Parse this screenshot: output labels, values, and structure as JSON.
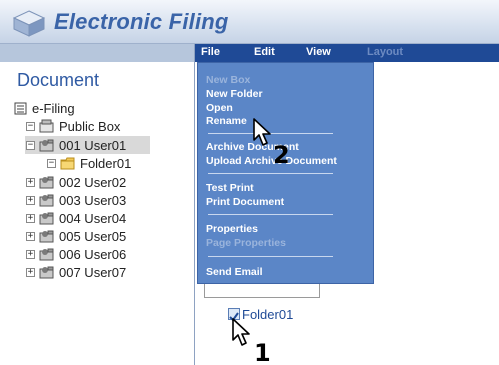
{
  "header": {
    "app_title": "Electronic Filing",
    "logo_icon": "cube-logo-icon"
  },
  "sidebar": {
    "heading": "Document",
    "root": "e-Filing",
    "items": [
      {
        "label": "Public Box",
        "expander": "−"
      },
      {
        "label": "001 User01",
        "expander": "−",
        "selected": true
      },
      {
        "label": "Folder01",
        "expander": "−"
      },
      {
        "label": "002 User02",
        "expander": "+"
      },
      {
        "label": "003 User03",
        "expander": "+"
      },
      {
        "label": "004 User04",
        "expander": "+"
      },
      {
        "label": "005 User05",
        "expander": "+"
      },
      {
        "label": "006 User06",
        "expander": "+"
      },
      {
        "label": "007 User07",
        "expander": "+"
      }
    ]
  },
  "menubar": {
    "file": "File",
    "edit": "Edit",
    "view": "View",
    "layout": "Layout"
  },
  "file_menu": {
    "new_box": "New Box",
    "new_folder": "New Folder",
    "open": "Open",
    "rename": "Rename",
    "archive": "Archive Document",
    "upload": "Upload Archive Document",
    "test_print": "Test Print",
    "print_document": "Print Document",
    "properties": "Properties",
    "page_properties": "Page Properties",
    "send_email": "Send Email"
  },
  "content": {
    "folder_item": "Folder01",
    "checkbox_checked": true
  },
  "annotations": {
    "step1": "1",
    "step2": "2"
  },
  "colors": {
    "menubar": "#1f4a96",
    "dropdown": "#5b86c7",
    "title": "#3a64a8",
    "heading": "#2f5aa3"
  }
}
